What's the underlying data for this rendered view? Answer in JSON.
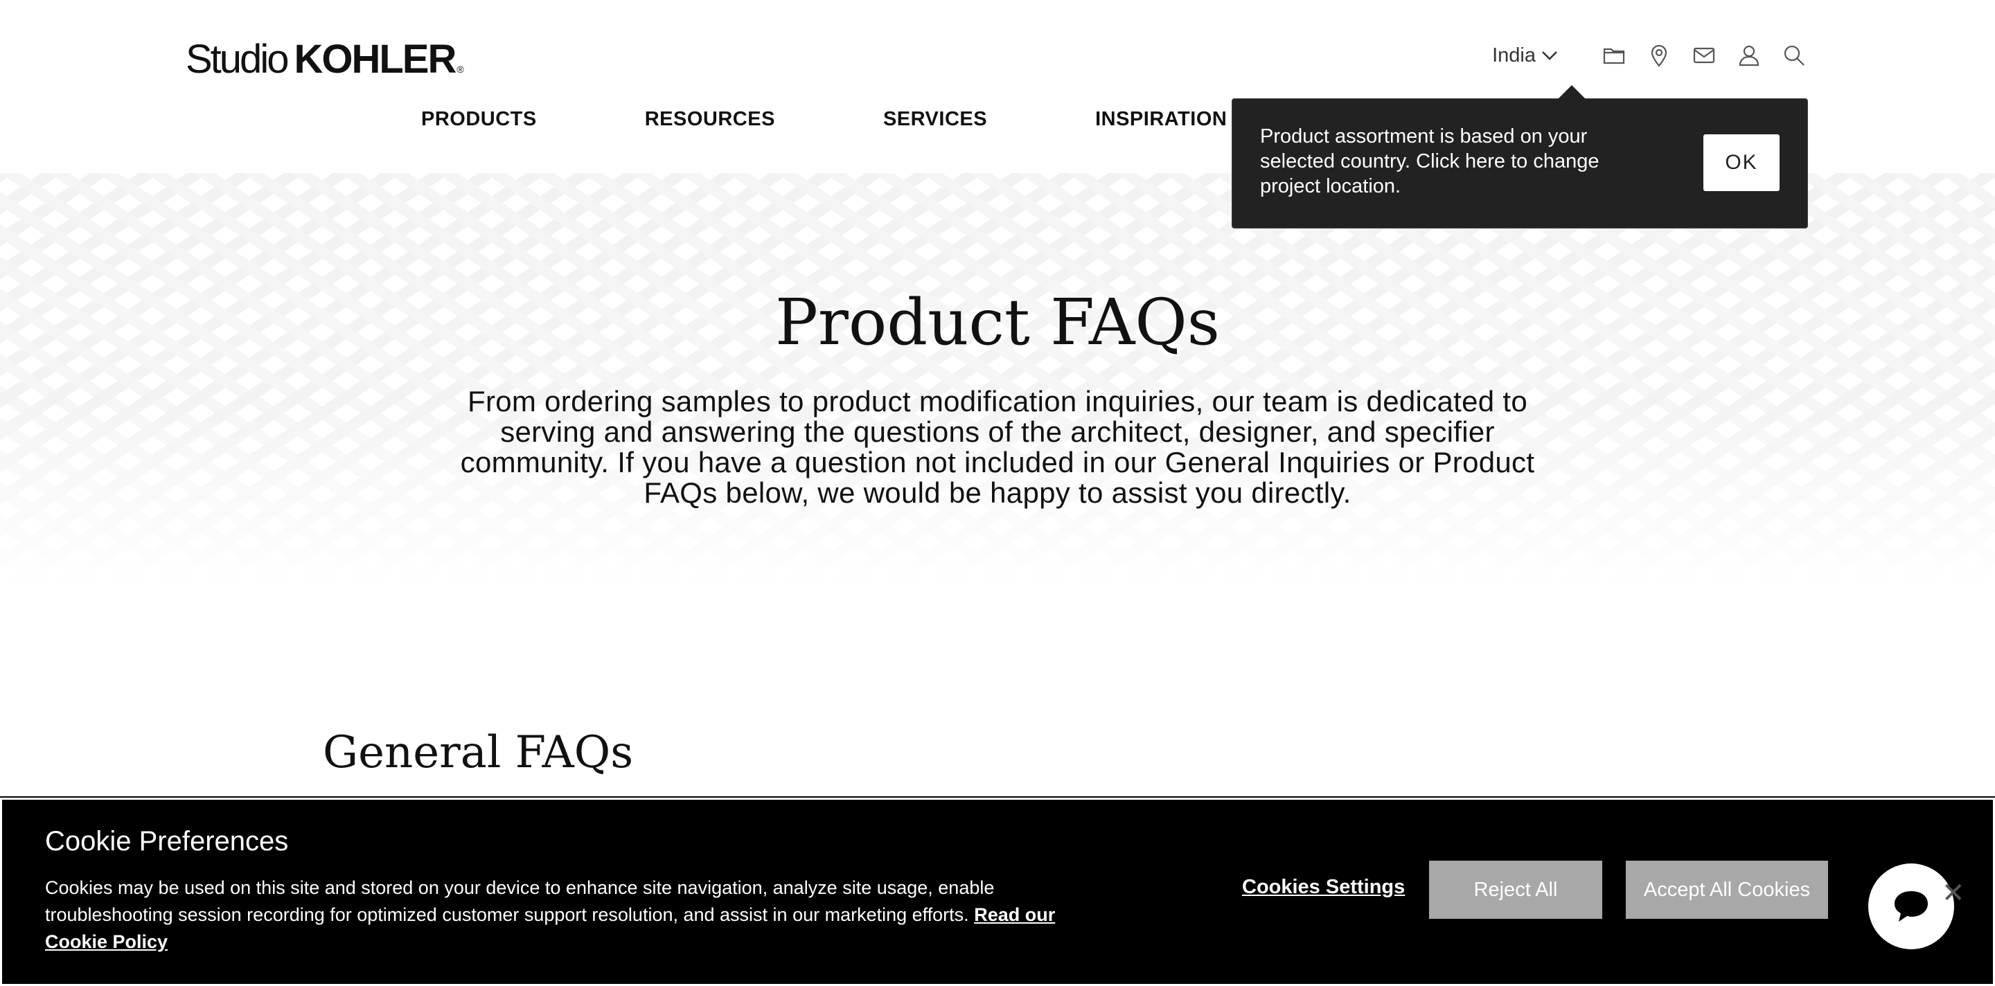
{
  "header": {
    "logo": {
      "studio": "Studio",
      "brand": "KOHLER",
      "reg": "®"
    },
    "country": "India",
    "icons": [
      "folder-icon",
      "location-pin-icon",
      "mail-icon",
      "user-icon",
      "search-icon"
    ]
  },
  "nav": {
    "items": [
      "PRODUCTS",
      "RESOURCES",
      "SERVICES",
      "INSPIRATION"
    ]
  },
  "tooltip": {
    "text": "Product assortment is based on your selected country. Click here to change project location.",
    "ok_label": "OK"
  },
  "hero": {
    "title": "Product FAQs",
    "description": "From ordering samples to product modification inquiries, our team is dedicated to serving and answering the questions of the architect, designer, and specifier community. If you have a question not included in our General Inquiries or Product FAQs below, we would be happy to assist you directly."
  },
  "section": {
    "title": "General FAQs"
  },
  "cookie": {
    "title": "Cookie Preferences",
    "text": "Cookies may be used on this site and stored on your device to enhance site navigation, analyze site usage, enable troubleshooting session recording for optimized customer support resolution, and assist in our marketing efforts.",
    "link": "Read our Cookie Policy",
    "settings_label": "Cookies Settings",
    "reject_label": "Reject All",
    "accept_label": "Accept All Cookies",
    "close_label": "✕"
  },
  "colors": {
    "tooltip_bg": "#222222",
    "cookie_bg": "#000000",
    "button_gray": "#a8a8a8"
  }
}
